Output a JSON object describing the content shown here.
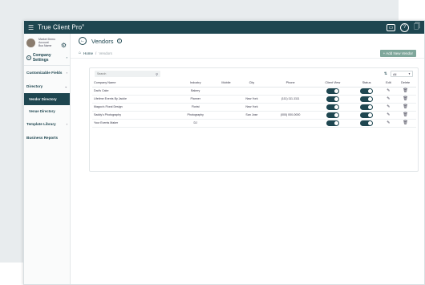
{
  "app": {
    "brand": "True Client Pro",
    "brand_mark": "®"
  },
  "profile": {
    "line1": "Market Demo",
    "line2": "Account",
    "line3": "Bus Name"
  },
  "company_settings": "Company Settings",
  "nav": {
    "customizable_fields": "Customizable Fields",
    "directory": "Directory",
    "vendor_directory": "Vendor Directory",
    "venue_directory": "Venue Directory",
    "template_library": "Template Library",
    "business_reports": "Business Reports"
  },
  "page": {
    "title": "Vendors",
    "breadcrumb_home": "Home",
    "breadcrumb_sep": "/",
    "breadcrumb_current": "Vendors",
    "add_button": "+ Add New Vendor"
  },
  "search": {
    "placeholder": "Search"
  },
  "filter": {
    "selected": "All"
  },
  "table": {
    "headers": [
      "Company Name",
      "Industry",
      "Mobile",
      "City",
      "Phone",
      "Client View",
      "Status",
      "Edit",
      "Delete"
    ],
    "rows": [
      {
        "company": "Dad's Cake",
        "industry": "Bakery",
        "mobile": "",
        "city": "",
        "phone": ""
      },
      {
        "company": "Lifetime Events By Jackie",
        "industry": "Planner",
        "mobile": "",
        "city": "New York",
        "phone": "(111) 111-1111"
      },
      {
        "company": "Magoo's Floral Design",
        "industry": "Florist",
        "mobile": "",
        "city": "New York",
        "phone": ""
      },
      {
        "company": "Saddy's Photography",
        "industry": "Photography",
        "mobile": "",
        "city": "San Jose",
        "phone": "(000) 000-0000"
      },
      {
        "company": "Your Events Maker",
        "industry": "DJ",
        "mobile": "",
        "city": "",
        "phone": ""
      }
    ]
  },
  "colors": {
    "primary": "#1e4650",
    "accent": "#7fa79b"
  }
}
